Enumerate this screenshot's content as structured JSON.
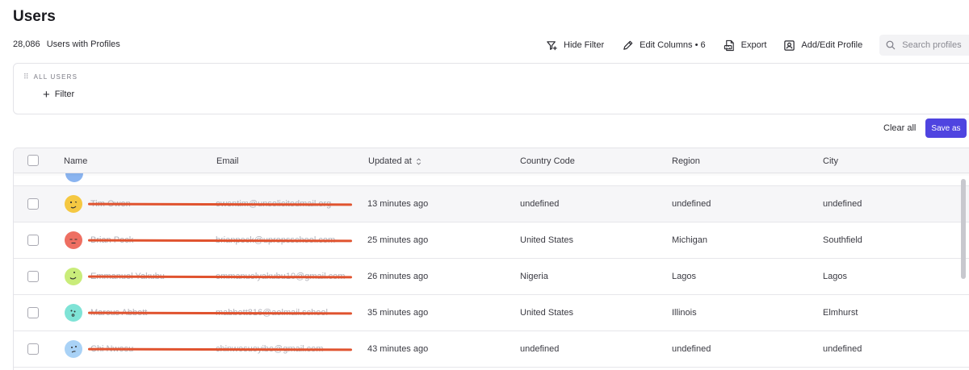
{
  "page": {
    "title": "Users",
    "count": "28,086",
    "count_label": "Users with Profiles"
  },
  "toolbar": {
    "hide_filter": "Hide Filter",
    "edit_columns": "Edit Columns • 6",
    "export": "Export",
    "add_edit_profile": "Add/Edit Profile",
    "search_placeholder": "Search profiles"
  },
  "filter": {
    "group_label": "ALL USERS",
    "add_filter": "Filter"
  },
  "actions": {
    "clear_all": "Clear all",
    "save_as": "Save as"
  },
  "table": {
    "columns": {
      "name": "Name",
      "email": "Email",
      "updated_at": "Updated at",
      "country_code": "Country Code",
      "region": "Region",
      "city": "City"
    },
    "rows": [
      {
        "name": "Tim Owen",
        "email": "owentim@unsolicitedmail.org",
        "updated": "13 minutes ago",
        "country": "undefined",
        "region": "undefined",
        "city": "undefined",
        "avatar_color": "#f5c842",
        "avatar_icon": "winking-face-icon"
      },
      {
        "name": "Brian Peck",
        "email": "brianpeck@upropsschool.com",
        "updated": "25 minutes ago",
        "country": "United States",
        "region": "Michigan",
        "city": "Southfield",
        "avatar_color": "#ee6f62",
        "avatar_icon": "sleepy-face-icon"
      },
      {
        "name": "Emmanuel Yakubu",
        "email": "emmanuelyakubu10@gmail.com",
        "updated": "26 minutes ago",
        "country": "Nigeria",
        "region": "Lagos",
        "city": "Lagos",
        "avatar_color": "#c9ec7a",
        "avatar_icon": "smiling-face-icon"
      },
      {
        "name": "Marcus Abbott",
        "email": "mabbott816@aolmail.school",
        "updated": "35 minutes ago",
        "country": "United States",
        "region": "Illinois",
        "city": "Elmhurst",
        "avatar_color": "#7fe3d6",
        "avatar_icon": "surprised-face-icon"
      },
      {
        "name": "Chi Nwosu",
        "email": "chinwosuoyibo@gmail.com",
        "updated": "43 minutes ago",
        "country": "undefined",
        "region": "undefined",
        "city": "undefined",
        "avatar_color": "#a9d2f6",
        "avatar_icon": "thinking-face-icon"
      }
    ]
  },
  "colors": {
    "accent": "#4f44e0",
    "redaction": "#e0532f"
  }
}
